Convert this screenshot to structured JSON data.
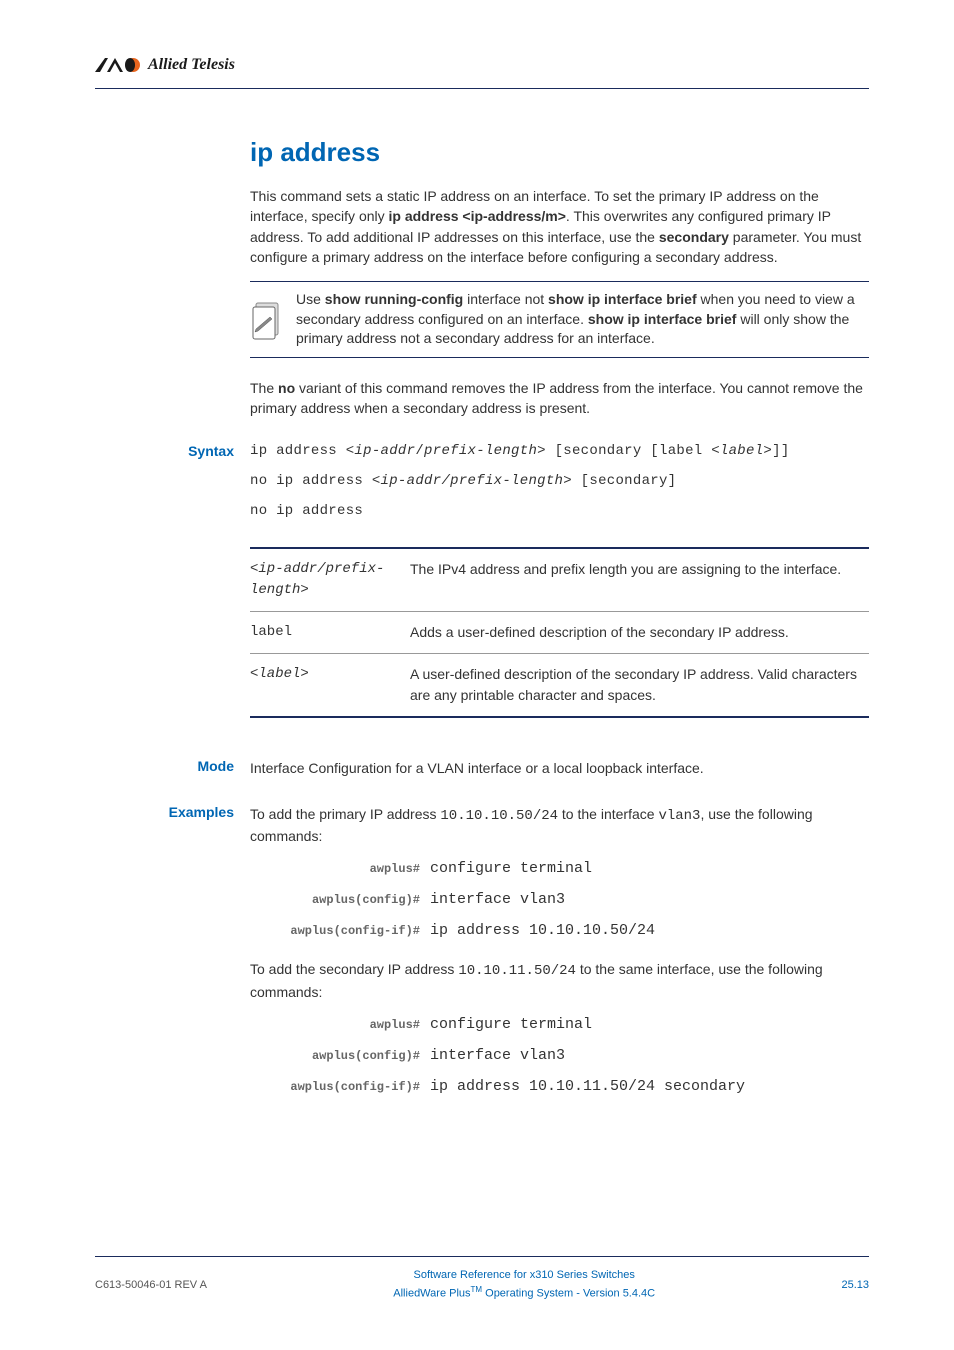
{
  "logo": {
    "text": "Allied Telesis"
  },
  "title": "ip address",
  "intro_parts": {
    "p1a": "This command sets a static IP address on an interface. To set the primary IP address on the interface, specify only ",
    "p1b": "ip address <ip-address/m>",
    "p1c": ". This overwrites any configured primary IP address. To add additional IP addresses on this interface, use the ",
    "p1d": "secondary",
    "p1e": " parameter. You must configure a primary address on the interface before configuring a secondary address."
  },
  "note_parts": {
    "a": "Use ",
    "b": "show running-config",
    "c": " interface not ",
    "d": "show ip interface brief",
    "e": " when you need to view a secondary address configured on an interface. ",
    "f": "show ip interface brief",
    "g": " will only show the primary address not a secondary address for an interface."
  },
  "no_variant_parts": {
    "a": "The ",
    "b": "no",
    "c": " variant of this command removes the IP address from the interface. You cannot remove the primary address when a secondary address is present."
  },
  "labels": {
    "syntax": "Syntax",
    "mode": "Mode",
    "examples": "Examples"
  },
  "syntax": {
    "line1_a": "ip address <",
    "line1_b": "ip-addr",
    "line1_c": "/",
    "line1_d": "prefix-length",
    "line1_e": "> [secondary [label <",
    "line1_f": "label",
    "line1_g": ">]]",
    "line2_a": "no ip address <",
    "line2_b": "ip-addr/prefix-length",
    "line2_c": "> [secondary]",
    "line3": "no ip address"
  },
  "params": [
    {
      "name": "<ip-addr/prefix-length>",
      "desc": "The IPv4 address and prefix length you are assigning to the interface."
    },
    {
      "name": "label",
      "desc": "Adds a user-defined description of the secondary IP address."
    },
    {
      "name": "<label>",
      "desc": "A user-defined description of the secondary IP address. Valid characters are any printable character and spaces."
    }
  ],
  "mode_text": "Interface Configuration for a VLAN interface or a local loopback interface.",
  "example1_parts": {
    "a": "To add the primary IP address ",
    "b": "10.10.10.50/24",
    "c": " to the interface ",
    "d": "vlan3",
    "e": ", use the following commands:"
  },
  "example1_cmds": [
    {
      "prompt": "awplus#",
      "cmd": "configure terminal"
    },
    {
      "prompt": "awplus(config)#",
      "cmd": "interface vlan3"
    },
    {
      "prompt": "awplus(config-if)#",
      "cmd": "ip address 10.10.10.50/24"
    }
  ],
  "example2_parts": {
    "a": "To add the secondary IP address ",
    "b": "10.10.11.50/24",
    "c": " to the same interface, use the following commands:"
  },
  "example2_cmds": [
    {
      "prompt": "awplus#",
      "cmd": "configure terminal"
    },
    {
      "prompt": "awplus(config)#",
      "cmd": "interface vlan3"
    },
    {
      "prompt": "awplus(config-if)#",
      "cmd": "ip address 10.10.11.50/24 secondary"
    }
  ],
  "footer": {
    "left": "C613-50046-01 REV A",
    "center_line1": "Software Reference for x310 Series Switches",
    "center_line2a": "AlliedWare Plus",
    "center_line2b": "TM",
    "center_line2c": " Operating System - Version 5.4.4C",
    "right": "25.13"
  }
}
